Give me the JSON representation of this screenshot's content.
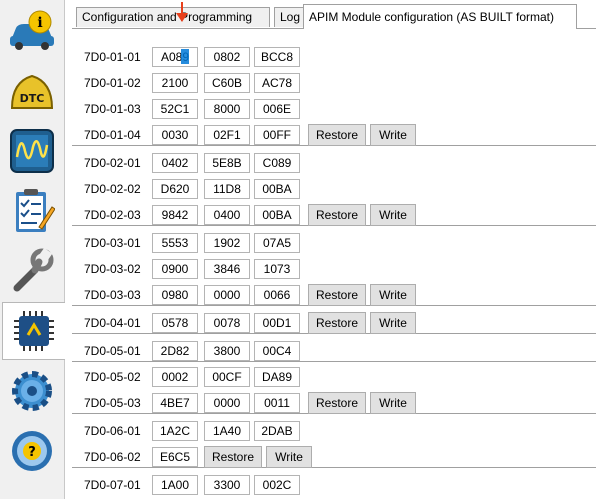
{
  "tabs": [
    {
      "label": "Configuration and Programming",
      "active": false
    },
    {
      "label": "Log",
      "active": false
    },
    {
      "label": "APIM Module configuration (AS BUILT format)",
      "active": true
    }
  ],
  "sidebar": {
    "items": [
      {
        "icon": "car-info-icon"
      },
      {
        "icon": "dtc-icon"
      },
      {
        "icon": "oscilloscope-icon"
      },
      {
        "icon": "checklist-icon"
      },
      {
        "icon": "wrench-icon"
      },
      {
        "icon": "chip-icon",
        "active": true
      },
      {
        "icon": "settings-gear-icon"
      },
      {
        "icon": "help-steering-wheel-icon"
      }
    ]
  },
  "buttons": {
    "restore": "Restore",
    "write": "Write"
  },
  "rows": [
    {
      "label": "7D0-01-01",
      "values": [
        "A089",
        "0802",
        "BCC8"
      ]
    },
    {
      "label": "7D0-01-02",
      "values": [
        "2100",
        "C60B",
        "AC78"
      ]
    },
    {
      "label": "7D0-01-03",
      "values": [
        "52C1",
        "8000",
        "006E"
      ]
    },
    {
      "label": "7D0-01-04",
      "values": [
        "0030",
        "02F1",
        "00FF"
      ],
      "actions": true
    },
    {
      "label": "7D0-02-01",
      "values": [
        "0402",
        "5E8B",
        "C089"
      ]
    },
    {
      "label": "7D0-02-02",
      "values": [
        "D620",
        "11D8",
        "00BA"
      ]
    },
    {
      "label": "7D0-02-03",
      "values": [
        "9842",
        "0400",
        "00BA"
      ],
      "actions": true
    },
    {
      "label": "7D0-03-01",
      "values": [
        "5553",
        "1902",
        "07A5"
      ]
    },
    {
      "label": "7D0-03-02",
      "values": [
        "0900",
        "3846",
        "1073"
      ]
    },
    {
      "label": "7D0-03-03",
      "values": [
        "0980",
        "0000",
        "0066"
      ],
      "actions": true
    },
    {
      "label": "7D0-04-01",
      "values": [
        "0578",
        "0078",
        "00D1"
      ],
      "actions": true
    },
    {
      "label": "7D0-05-01",
      "values": [
        "2D82",
        "3800",
        "00C4"
      ]
    },
    {
      "label": "7D0-05-02",
      "values": [
        "0002",
        "00CF",
        "DA89"
      ]
    },
    {
      "label": "7D0-05-03",
      "values": [
        "4BE7",
        "0000",
        "0011"
      ],
      "actions": true
    },
    {
      "label": "7D0-06-01",
      "values": [
        "1A2C",
        "1A40",
        "2DAB"
      ]
    },
    {
      "label": "7D0-06-02",
      "values": [
        "E6C5"
      ],
      "actions": true
    },
    {
      "label": "7D0-07-01",
      "values": [
        "1A00",
        "3300",
        "002C"
      ]
    }
  ],
  "colors": {
    "arrow": "#e8401c",
    "selection": "#0078d7"
  }
}
